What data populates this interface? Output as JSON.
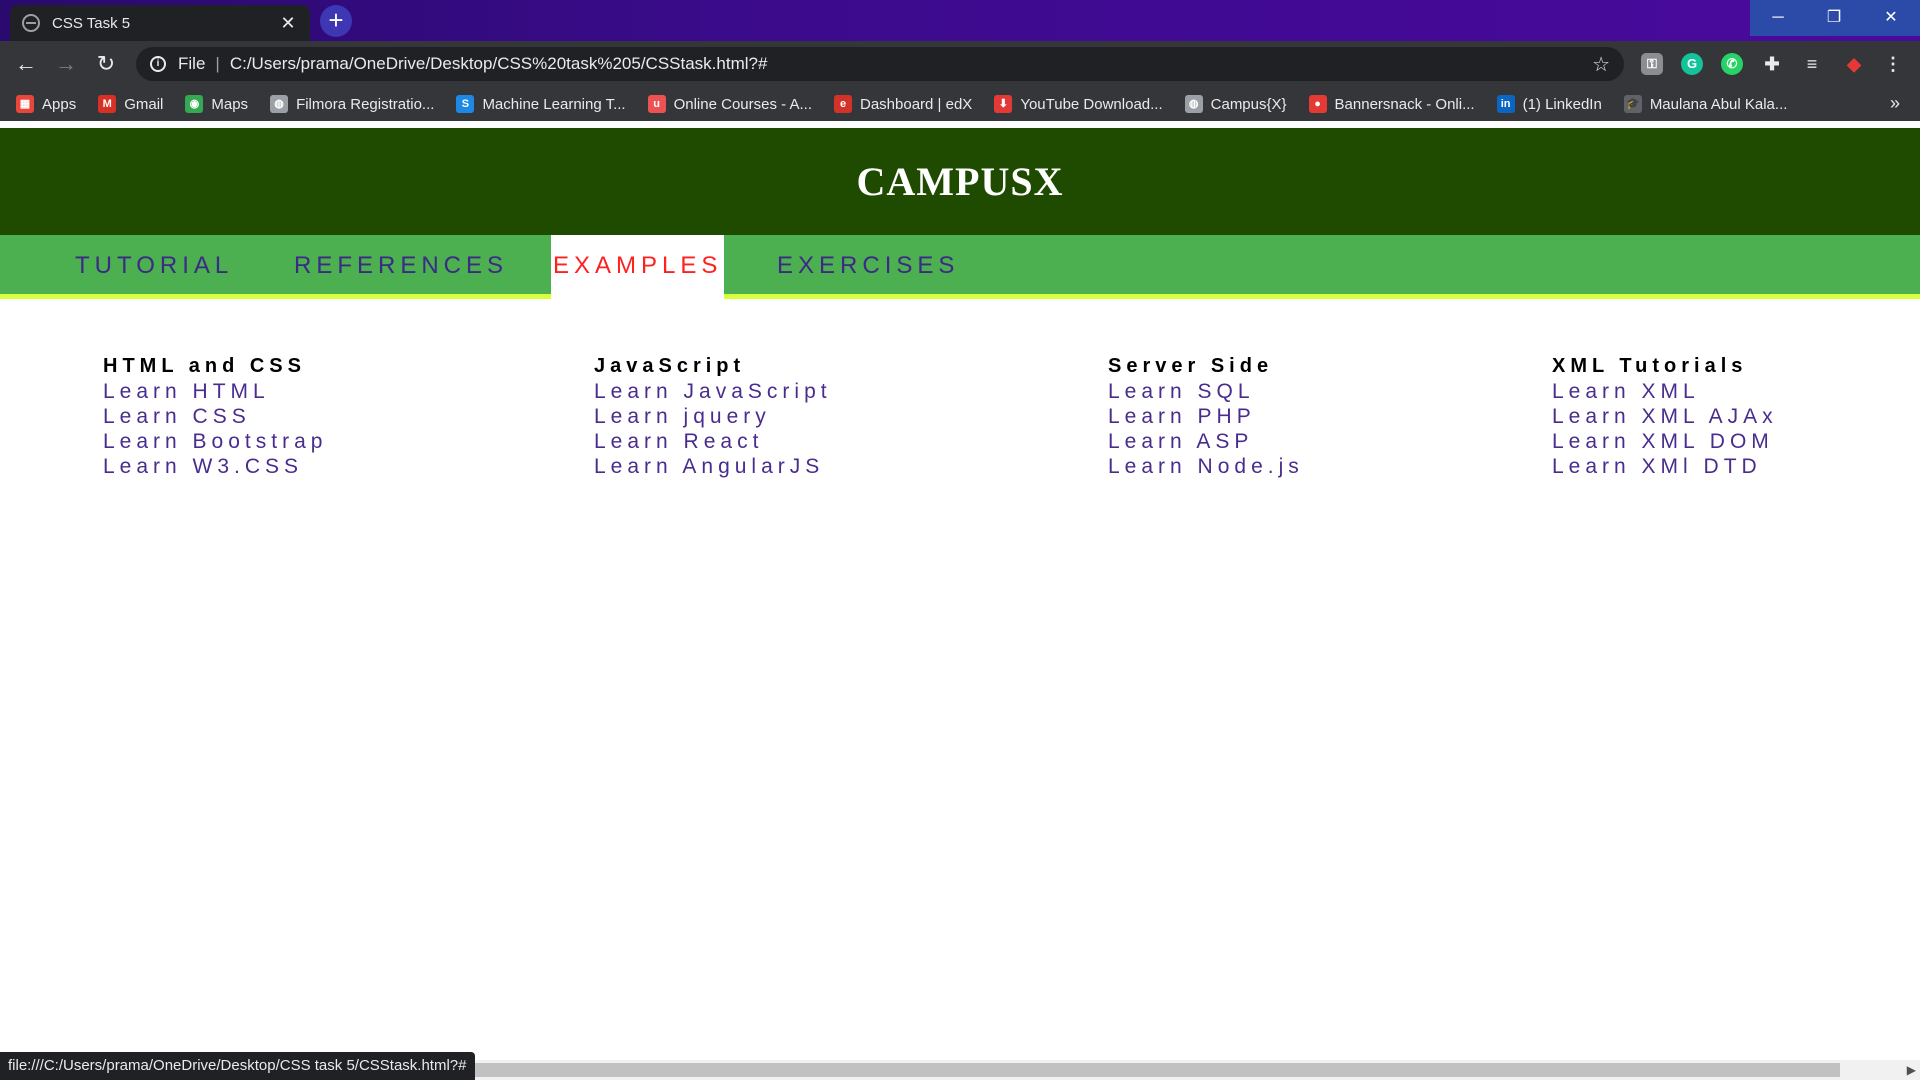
{
  "browser": {
    "tab_title": "CSS Task 5",
    "new_tab": "+",
    "close_tab": "✕",
    "scheme": "File",
    "url": "C:/Users/prama/OneDrive/Desktop/CSS%20task%205/CSStask.html?#",
    "status_url": "file:///C:/Users/prama/OneDrive/Desktop/CSS task 5/CSStask.html?#",
    "bookmarks": [
      {
        "label": "Apps",
        "icon": "apps-grid-icon",
        "color": "#e8453c"
      },
      {
        "label": "Gmail",
        "icon": "gmail-icon",
        "color": "#d93025"
      },
      {
        "label": "Maps",
        "icon": "maps-pin-icon",
        "color": "#34a853"
      },
      {
        "label": "Filmora Registratio...",
        "icon": "globe-icon",
        "color": "#9aa0a6"
      },
      {
        "label": "Machine Learning T...",
        "icon": "s-logo-icon",
        "color": "#1e88e5"
      },
      {
        "label": "Online Courses - A...",
        "icon": "udemy-icon",
        "color": "#ec5252"
      },
      {
        "label": "Dashboard | edX",
        "icon": "edx-icon",
        "color": "#d23228"
      },
      {
        "label": "YouTube Download...",
        "icon": "download-icon",
        "color": "#e53935"
      },
      {
        "label": "Campus{X}",
        "icon": "globe-icon",
        "color": "#9aa0a6"
      },
      {
        "label": "Bannersnack - Onli...",
        "icon": "bannersnack-icon",
        "color": "#e53935"
      },
      {
        "label": "(1) LinkedIn",
        "icon": "linkedin-icon",
        "color": "#0a66c2"
      },
      {
        "label": "Maulana Abul Kala...",
        "icon": "graduation-cap-icon",
        "color": "#5f6368"
      }
    ]
  },
  "site": {
    "title": "CAMPUSX",
    "nav": [
      {
        "label": "TUTORIAL",
        "active": false
      },
      {
        "label": "REFERENCES",
        "active": false
      },
      {
        "label": "EXAMPLES",
        "active": true
      },
      {
        "label": "EXERCISES",
        "active": false
      }
    ],
    "columns": [
      {
        "title": "HTML and CSS",
        "links": [
          "Learn HTML",
          "Learn CSS",
          "Learn Bootstrap",
          "Learn W3.CSS"
        ]
      },
      {
        "title": "JavaScript",
        "links": [
          "Learn JavaScript",
          "Learn jquery",
          "Learn React",
          "Learn AngularJS"
        ]
      },
      {
        "title": "Server Side",
        "links": [
          "Learn SQL",
          "Learn PHP",
          "Learn ASP",
          "Learn Node.js"
        ]
      },
      {
        "title": "XML Tutorials",
        "links": [
          "Learn XML",
          "Learn XML AJAx",
          "Learn XML DOM",
          "Learn XMl DTD"
        ]
      }
    ]
  },
  "colors": {
    "header_bg": "#1f4b00",
    "nav_bg": "#4caf50",
    "nav_underline": "#d9ff3a",
    "nav_text": "#3b2a86",
    "nav_active_text": "#ff2020",
    "link_text": "#4a2c8f"
  }
}
